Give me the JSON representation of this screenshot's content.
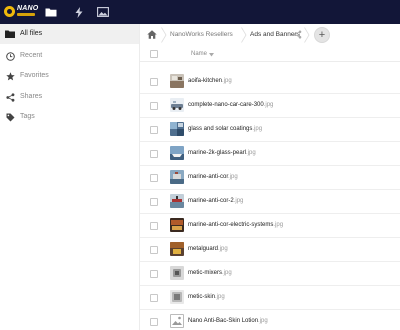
{
  "header": {
    "logo_text": "NANO",
    "apps": [
      {
        "name": "files",
        "icon": "folder-icon"
      },
      {
        "name": "activity",
        "icon": "lightning-icon"
      },
      {
        "name": "photos",
        "icon": "image-icon"
      }
    ],
    "bg_color": "#121638",
    "logo_color": "#f0b90b"
  },
  "nav": {
    "items": [
      {
        "label": "All files",
        "icon": "folder-icon",
        "active": true
      },
      {
        "label": "Recent",
        "icon": "clock-icon",
        "active": false
      },
      {
        "label": "Favorites",
        "icon": "star-icon",
        "active": false
      },
      {
        "label": "Shares",
        "icon": "share-icon",
        "active": false
      },
      {
        "label": "Tags",
        "icon": "tag-icon",
        "active": false
      }
    ]
  },
  "breadcrumb": {
    "items": [
      "NanoWorks Resellers",
      "Ads and Banners"
    ],
    "add_label": "+"
  },
  "list": {
    "name_header": "Name",
    "files": [
      {
        "name": "aoifa-kitchen",
        "ext": ".jpg",
        "thumb": "kitchen"
      },
      {
        "name": "complete-nano-car-care-300",
        "ext": ".jpg",
        "thumb": "car"
      },
      {
        "name": "glass and solar coatings",
        "ext": ".jpg",
        "thumb": "glass"
      },
      {
        "name": "marine-2k-glass-pearl",
        "ext": ".jpg",
        "thumb": "marine"
      },
      {
        "name": "marine-anti-cor",
        "ext": ".jpg",
        "thumb": "marine2"
      },
      {
        "name": "marine-anti-cor-2",
        "ext": ".jpg",
        "thumb": "marine3"
      },
      {
        "name": "marine-anti-cor-electric-systems",
        "ext": ".jpg",
        "thumb": "electric"
      },
      {
        "name": "metalguard",
        "ext": ".jpg",
        "thumb": "metal"
      },
      {
        "name": "metic-mixers",
        "ext": ".jpg",
        "thumb": "mixers"
      },
      {
        "name": "metic-skin",
        "ext": ".jpg",
        "thumb": "skin"
      },
      {
        "name": "Nano Anti-Bac-Skin Lotion",
        "ext": ".jpg",
        "thumb": "placeholder"
      }
    ]
  }
}
